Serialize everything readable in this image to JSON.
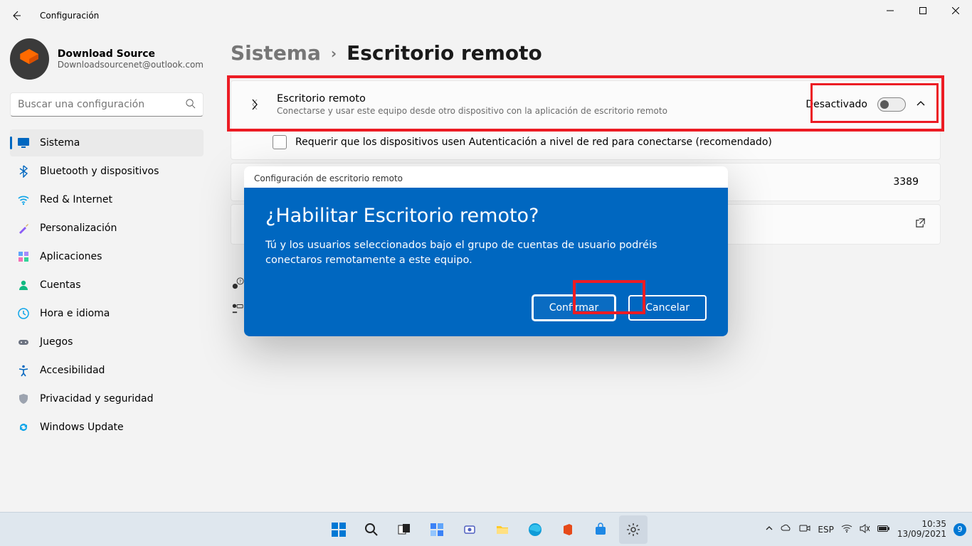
{
  "window": {
    "title": "Configuración"
  },
  "profile": {
    "name": "Download Source",
    "email": "Downloadsourcenet@outlook.com"
  },
  "search": {
    "placeholder": "Buscar una configuración"
  },
  "nav": {
    "items": [
      {
        "label": "Sistema",
        "icon": "display",
        "active": true
      },
      {
        "label": "Bluetooth y dispositivos",
        "icon": "bluetooth"
      },
      {
        "label": "Red & Internet",
        "icon": "wifi"
      },
      {
        "label": "Personalización",
        "icon": "brush"
      },
      {
        "label": "Aplicaciones",
        "icon": "apps"
      },
      {
        "label": "Cuentas",
        "icon": "person"
      },
      {
        "label": "Hora e idioma",
        "icon": "clock"
      },
      {
        "label": "Juegos",
        "icon": "gamepad"
      },
      {
        "label": "Accesibilidad",
        "icon": "accessibility"
      },
      {
        "label": "Privacidad y seguridad",
        "icon": "shield"
      },
      {
        "label": "Windows Update",
        "icon": "update"
      }
    ]
  },
  "breadcrumb": {
    "parent": "Sistema",
    "current": "Escritorio remoto"
  },
  "main": {
    "remote": {
      "title": "Escritorio remoto",
      "subtitle": "Conectarse y usar este equipo desde otro dispositivo con la aplicación de escritorio remoto",
      "toggle_label": "Desactivado"
    },
    "nla_label": "Requerir que los dispositivos usen Autenticación a nivel de red para conectarse (recomendado)",
    "port_value": "3389"
  },
  "dialog": {
    "title": "Configuración de escritorio remoto",
    "heading": "¿Habilitar Escritorio remoto?",
    "body": "Tú y los usuarios seleccionados bajo el grupo de cuentas de usuario podréis conectaros remotamente a este equipo.",
    "confirm": "Confirmar",
    "cancel": "Cancelar"
  },
  "taskbar": {
    "tray_lang": "ESP",
    "time": "10:35",
    "date": "13/09/2021",
    "badge": "9"
  }
}
